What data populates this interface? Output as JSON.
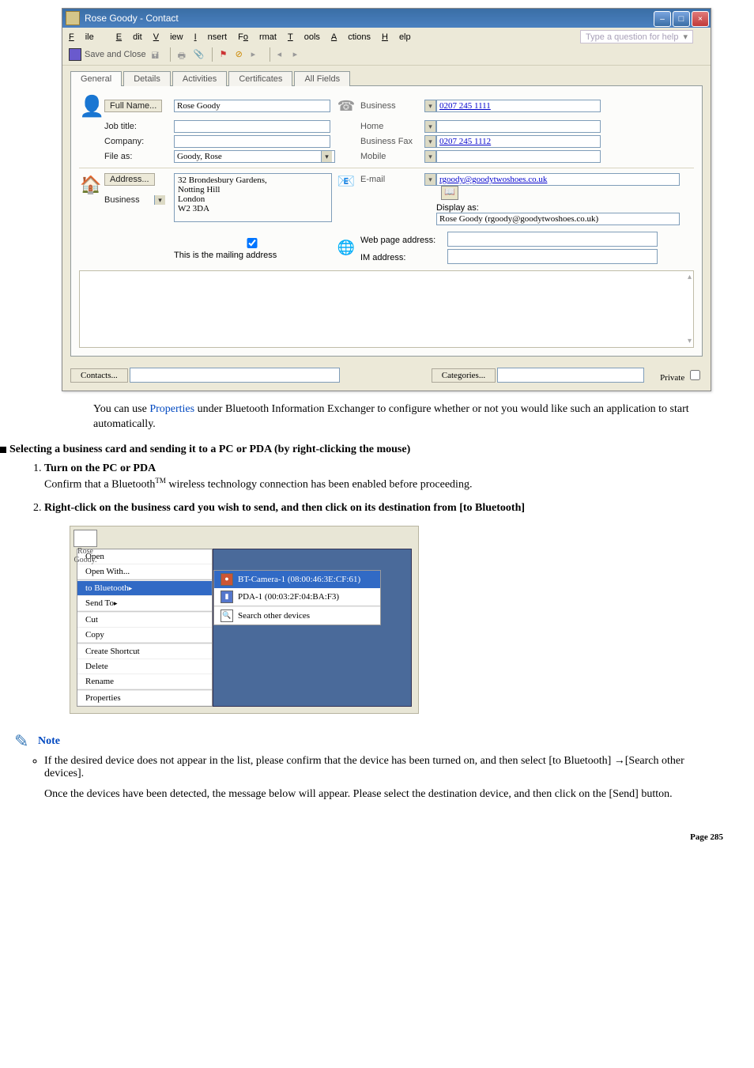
{
  "window": {
    "title": "Rose Goody - Contact",
    "menus": {
      "file": "File",
      "edit": "Edit",
      "view": "View",
      "insert": "Insert",
      "format": "Format",
      "tools": "Tools",
      "actions": "Actions",
      "help": "Help"
    },
    "help_placeholder": "Type a question for help",
    "save_close": "Save and Close",
    "tabs": {
      "general": "General",
      "details": "Details",
      "activities": "Activities",
      "certificates": "Certificates",
      "allfields": "All Fields"
    },
    "labels": {
      "full_name": "Full Name...",
      "job_title": "Job title:",
      "company": "Company:",
      "file_as": "File as:",
      "business": "Business",
      "home": "Home",
      "business_fax": "Business Fax",
      "mobile": "Mobile",
      "address": "Address...",
      "addr_type": "Business",
      "email": "E-mail",
      "display_as": "Display as:",
      "mailing": "This is the mailing address",
      "web": "Web page address:",
      "im": "IM address:"
    },
    "values": {
      "full_name": "Rose Goody",
      "file_as": "Goody, Rose",
      "phone_business": "0207 245 1111",
      "phone_fax": "0207 245 1112",
      "address": "32  Brondesbury Gardens,\nNotting Hill\nLondon\nW2 3DA",
      "email": "rgoody@goodytwoshoes.co.uk",
      "display_as": "Rose Goody (rgoody@goodytwoshoes.co.uk)"
    },
    "footer": {
      "contacts": "Contacts...",
      "categories": "Categories...",
      "private": "Private"
    }
  },
  "body": {
    "under_fig": {
      "pre": "You can use ",
      "link": "Properties",
      "post": " under Bluetooth Information Exchanger to configure whether or not you would like such an application to start automatically."
    },
    "section": "Selecting a business card and sending it to a PC or PDA (by right-clicking the mouse)",
    "step1_title": "Turn on the PC or PDA",
    "step1_body_pre": "Confirm that a Bluetooth",
    "step1_body_post": " wireless technology connection has been enabled before proceeding.",
    "step2_title": "Right-click on the business card you wish to send, and then click on its destination from [to Bluetooth]"
  },
  "context_menu": {
    "card_label": "Rose\nGoody.",
    "items": {
      "open": "Open",
      "open_with": "Open With...",
      "to_bt": "to Bluetooth",
      "send_to": "Send To",
      "cut": "Cut",
      "copy": "Copy",
      "shortcut": "Create Shortcut",
      "delete": "Delete",
      "rename": "Rename",
      "properties": "Properties"
    },
    "submenu": {
      "cam": "BT-Camera-1 (08:00:46:3E:CF:61)",
      "pda": "PDA-1 (00:03:2F:04:BA:F3)",
      "search": "Search other devices"
    }
  },
  "note": {
    "label": "Note",
    "bullet_a": "If the desired device does not appear in the list, please confirm that the device has been turned on, and then select [to Bluetooth] →[Search other devices].",
    "bullet_b": "Once the devices have been detected, the message below will appear. Please select the destination device, and then click on the [Send] button."
  },
  "page_no": {
    "label": "Page",
    "num": "285"
  }
}
